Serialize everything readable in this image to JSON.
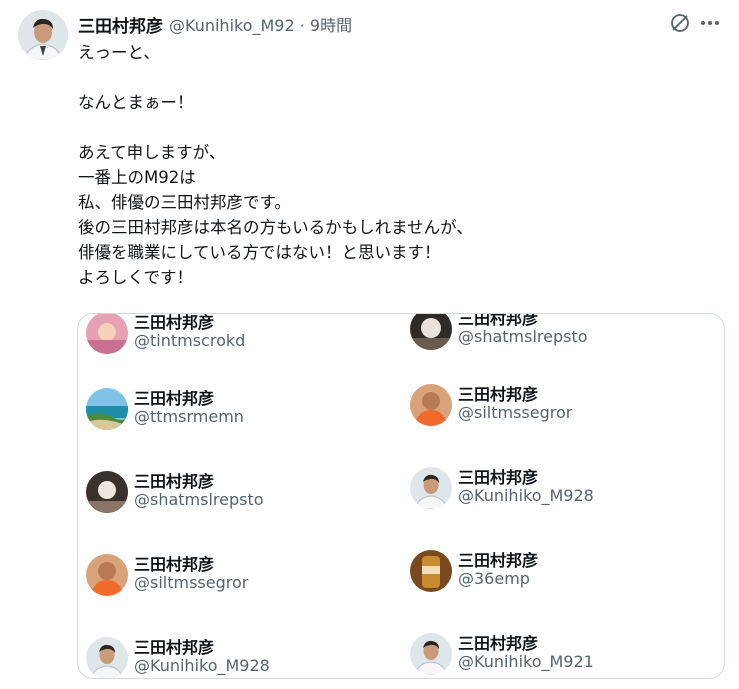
{
  "tweet": {
    "author_name": "三田村邦彦",
    "author_meta": "@Kunihiko_M92 · 9時間",
    "icons": {
      "action": "no-entry-icon",
      "more": "more-icon"
    },
    "lines": [
      "えっーと、",
      "",
      "なんとまぁー！",
      "",
      "あえて申しますが、",
      "一番上のM92は",
      "私、俳優の三田村邦彦です。",
      "後の三田村邦彦は本名の方もいるかもしれませんが、",
      "俳優を職業にしている方ではない！と思います！",
      "よろしくです！"
    ]
  },
  "card": {
    "accounts": [
      {
        "name": "三田村邦彦",
        "handle": "@tintmscrokd",
        "photo": "pink-photo"
      },
      {
        "name": "三田村邦彦",
        "handle": "@shatmslrepsto",
        "photo": "dark-photo"
      },
      {
        "name": "三田村邦彦",
        "handle": "@ttmsrmemn",
        "photo": "beach-photo"
      },
      {
        "name": "三田村邦彦",
        "handle": "@siltmssegror",
        "photo": "orange-photo"
      },
      {
        "name": "三田村邦彦",
        "handle": "@shatmslrepsto",
        "photo": "dark-photo"
      },
      {
        "name": "三田村邦彦",
        "handle": "@Kunihiko_M928",
        "photo": "portrait-photo"
      },
      {
        "name": "三田村邦彦",
        "handle": "@siltmssegror",
        "photo": "orange-photo"
      },
      {
        "name": "三田村邦彦",
        "handle": "@36emp",
        "photo": "can-photo"
      },
      {
        "name": "三田村邦彦",
        "handle": "@Kunihiko_M928",
        "photo": "portrait-photo"
      },
      {
        "name": "三田村邦彦",
        "handle": "@Kunihiko_M921",
        "photo": "portrait-photo"
      }
    ]
  }
}
